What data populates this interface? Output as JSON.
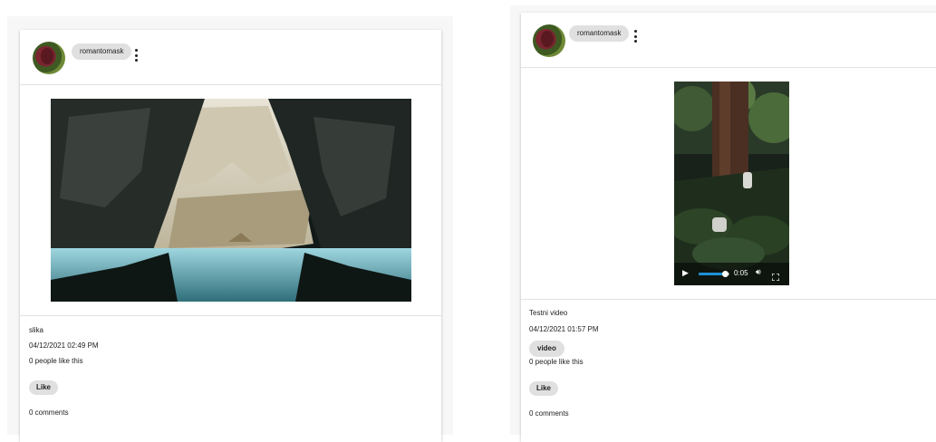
{
  "posts": [
    {
      "author": "romantomask",
      "caption": "slika",
      "date": "04/12/2021 02:49 PM",
      "likes_text": "0 people like this",
      "like_label": "Like",
      "comments_text": "0 comments",
      "media_type": "image"
    },
    {
      "author": "romantomask",
      "caption": "Testni video",
      "date": "04/12/2021 01:57 PM",
      "tag": "video",
      "likes_text": "0 people like this",
      "like_label": "Like",
      "comments_text": "0 comments",
      "media_type": "video",
      "video": {
        "current_time": "0:05",
        "progress": 0.85
      }
    }
  ],
  "icons": {
    "menu": "more-vertical-icon",
    "play": "play-icon",
    "volume": "volume-icon",
    "fullscreen": "fullscreen-icon"
  },
  "colors": {
    "video_progress": "#1e90d6",
    "chip": "#e0e0e0"
  }
}
